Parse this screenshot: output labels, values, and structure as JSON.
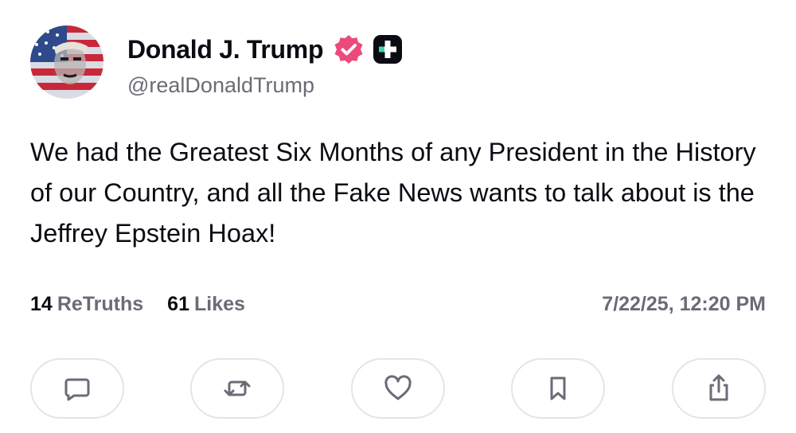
{
  "author": {
    "display_name": "Donald J. Trump",
    "handle": "@realDonaldTrump",
    "avatar_icon": "american-flag-portrait",
    "verified_icon": "verified-badge-icon",
    "verified_color": "#ec4a7b",
    "plus_icon": "truth-plus-icon"
  },
  "post": {
    "text": "We had the Greatest Six Months of any President in the History of our Country, and all the Fake News wants to talk about is the Jeffrey Epstein Hoax!"
  },
  "stats": {
    "retruths_count": "14",
    "retruths_label": "ReTruths",
    "likes_count": "61",
    "likes_label": "Likes",
    "timestamp": "7/22/25, 12:20 PM"
  },
  "actions": [
    {
      "name": "reply",
      "icon": "comment-icon"
    },
    {
      "name": "retruth",
      "icon": "repost-icon"
    },
    {
      "name": "like",
      "icon": "heart-icon"
    },
    {
      "name": "bookmark",
      "icon": "bookmark-icon"
    },
    {
      "name": "share",
      "icon": "share-icon"
    }
  ],
  "colors": {
    "text": "#0b0b14",
    "muted": "#6b6b78",
    "border": "#e4e4ea",
    "accent": "#ec4a7b"
  }
}
